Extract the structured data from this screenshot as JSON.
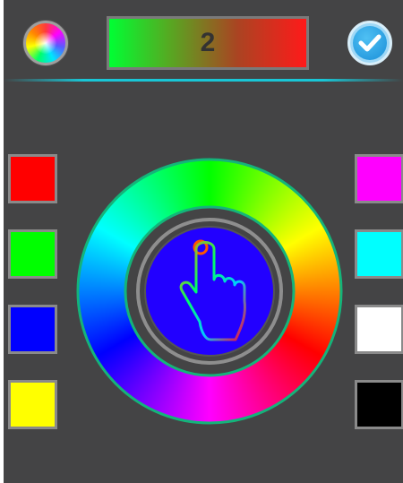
{
  "toolbar": {
    "value_display": "2",
    "gradient_colors": [
      "#00ff33",
      "#55aa22",
      "#aa4422",
      "#ff1a1a"
    ]
  },
  "palette": {
    "left": [
      {
        "name": "red",
        "color": "#ff0000"
      },
      {
        "name": "green",
        "color": "#00ff00"
      },
      {
        "name": "blue",
        "color": "#0000ff"
      },
      {
        "name": "yellow",
        "color": "#ffff00"
      }
    ],
    "right": [
      {
        "name": "magenta",
        "color": "#ff00ff"
      },
      {
        "name": "cyan",
        "color": "#00ffff"
      },
      {
        "name": "white",
        "color": "#ffffff"
      },
      {
        "name": "black",
        "color": "#000000"
      }
    ]
  },
  "selected_color": "#2200ff",
  "icons": {
    "left_button": "color-wheel-icon",
    "right_button": "checkmark-icon",
    "center": "touch-hand-icon"
  }
}
